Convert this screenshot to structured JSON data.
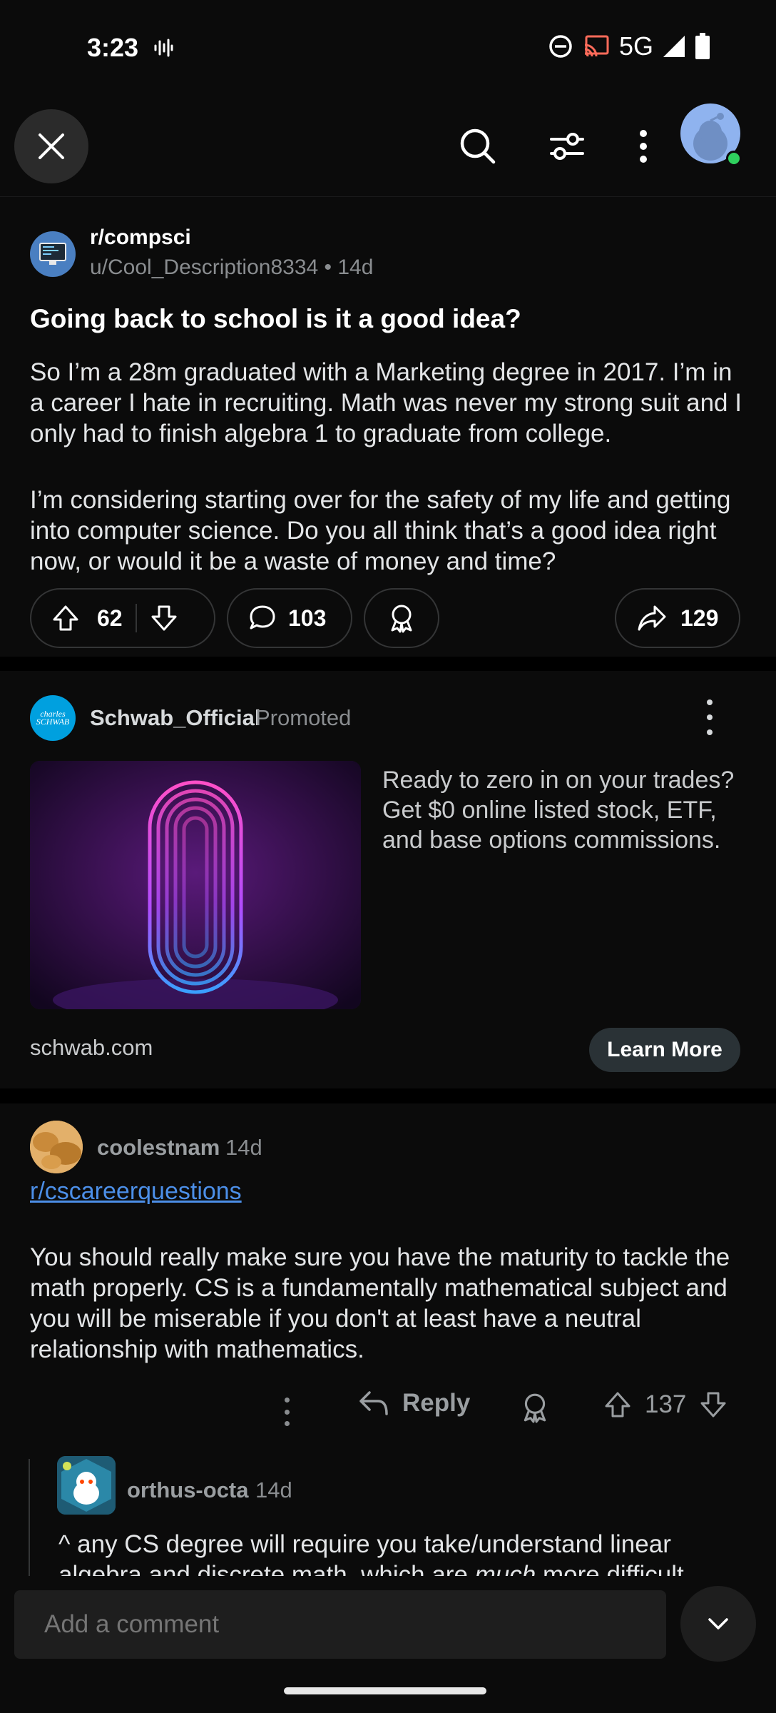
{
  "status_bar": {
    "time": "3:23",
    "network": "5G"
  },
  "header": {
    "close": "close",
    "search": "search",
    "filter": "filter",
    "more": "more"
  },
  "post": {
    "subreddit": "r/compsci",
    "meta": "u/Cool_Description8334 • 14d",
    "title": "Going back to school is it a good idea?",
    "body": [
      "So I’m a 28m graduated with a Marketing degree in 2017. I’m in a career I hate in recruiting. Math was never my strong suit and I only had to finish algebra 1 to graduate from college.",
      "I’m considering starting over for the safety of my life and getting into computer science. Do you all think that’s a good idea right now, or would it be a waste of money and time?"
    ],
    "votes": "62",
    "comments": "103",
    "shares": "129"
  },
  "ad": {
    "logo_text": "charles SCHWAB",
    "advertiser": "Schwab_Official",
    "label": "Promoted",
    "text": "Ready to zero in on your trades? Get $0 online listed stock, ETF, and base options commissions.",
    "domain": "schwab.com",
    "cta": "Learn More"
  },
  "comment": {
    "author": "coolestnam",
    "time": "14d",
    "link": "r/cscareerquestions",
    "body": "You should really make sure you have the maturity to tackle the math properly. CS is a fundamentally mathematical subject and you will be miserable if you don't at least have a neutral relationship with mathematics.",
    "reply_label": "Reply",
    "votes": "137"
  },
  "reply": {
    "author": "orthus-octa",
    "time": "14d",
    "body_prefix": "^ any CS degree will require you take/understand linear algebra and discrete math, which are ",
    "body_emph": "much",
    "body_suffix": " more difficult"
  },
  "bottom": {
    "placeholder": "Add a comment"
  },
  "colors": {
    "background": "#0b0b0b",
    "link": "#4c8fe8",
    "online": "#2fd05e"
  }
}
